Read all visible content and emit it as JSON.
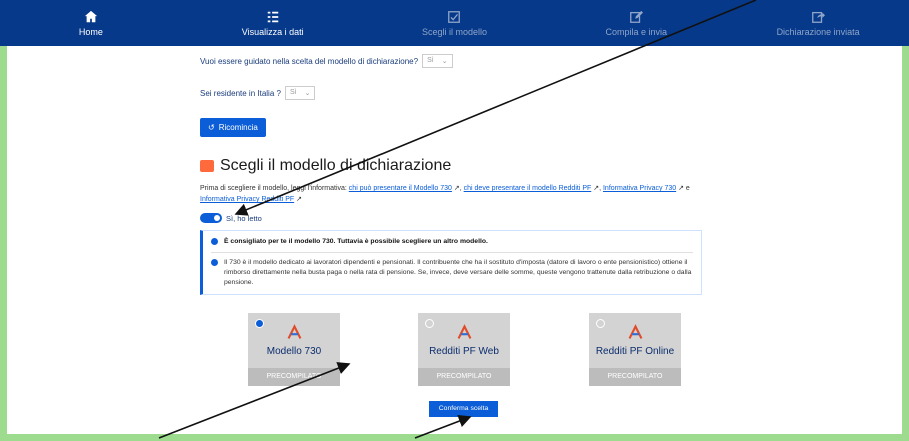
{
  "nav": {
    "items": [
      {
        "label": "Home",
        "icon": "home-icon"
      },
      {
        "label": "Visualizza i dati",
        "icon": "list-icon"
      },
      {
        "label": "Scegli il modello",
        "icon": "checkbox-icon"
      },
      {
        "label": "Compila e invia",
        "icon": "edit-icon"
      },
      {
        "label": "Dichiarazione inviata",
        "icon": "share-icon"
      }
    ]
  },
  "questions": {
    "guided": {
      "label": "Vuoi essere guidato nella scelta del modello di dichiarazione?",
      "value": "Sì"
    },
    "resident": {
      "label": "Sei residente in Italia ?",
      "value": "Sì"
    }
  },
  "restart_button": "Ricomincia",
  "section": {
    "title": "Scegli il modello di dichiarazione",
    "intro_prefix": "Prima di scegliere il modello, leggi l'informativa:",
    "link1": "chi può presentare il Modello 730",
    "link2": "chi deve presentare il modello Redditi PF",
    "link3": "Informativa Privacy 730",
    "link4": "Informativa Privacy Redditi PF",
    "and": "e",
    "read_toggle": "Sì, ho letto"
  },
  "info": {
    "line1": "È consigliato per te il modello 730. Tuttavia è possibile scegliere un altro modello.",
    "line2": "Il 730 è il modello dedicato ai lavoratori dipendenti e pensionati. Il contribuente che ha il sostituto d'imposta (datore di lavoro o ente pensionistico) ottiene il rimborso direttamente nella busta paga o nella rata di pensione. Se, invece, deve versare delle somme, queste vengono trattenute dalla retribuzione o dalla pensione."
  },
  "cards": [
    {
      "title": "Modello 730",
      "sub": "PRECOMPILATO",
      "checked": true
    },
    {
      "title": "Redditi PF Web",
      "sub": "PRECOMPILATO",
      "checked": false
    },
    {
      "title": "Redditi PF Online",
      "sub": "PRECOMPILATO",
      "checked": false
    }
  ],
  "confirm_button": "Conferma scelta",
  "colors": {
    "nav": "#06398a",
    "primary": "#0b5ed7",
    "frame": "#9ddc8f"
  }
}
